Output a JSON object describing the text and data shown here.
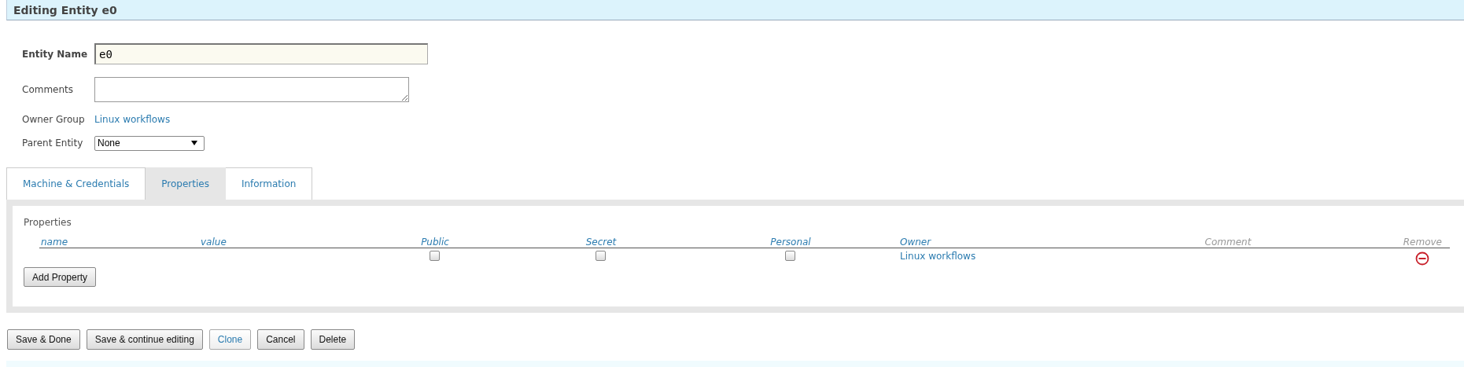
{
  "header": {
    "title": "Editing Entity e0"
  },
  "form": {
    "entity_name": {
      "label": "Entity Name",
      "value": "e0"
    },
    "comments": {
      "label": "Comments"
    },
    "owner_group": {
      "label": "Owner Group",
      "value": "Linux workflows"
    },
    "parent_entity": {
      "label": "Parent Entity",
      "value": "None"
    }
  },
  "tabs": [
    {
      "label": "Machine & Credentials",
      "selected": false
    },
    {
      "label": "Properties",
      "selected": true
    },
    {
      "label": "Information",
      "selected": false
    }
  ],
  "properties": {
    "title": "Properties",
    "columns": [
      {
        "label": "name",
        "kind": "text"
      },
      {
        "label": "value",
        "kind": "text"
      },
      {
        "label": "Public",
        "kind": "check"
      },
      {
        "label": "Secret",
        "kind": "check"
      },
      {
        "label": "Personal",
        "kind": "check"
      },
      {
        "label": "Owner",
        "kind": "link"
      },
      {
        "label": "Comment",
        "kind": "muted"
      },
      {
        "label": "Remove",
        "kind": "remove"
      }
    ],
    "rows": [
      {
        "public": false,
        "secret": false,
        "personal": false,
        "owner": "Linux workflows"
      }
    ],
    "add_button": "Add Property"
  },
  "buttons": [
    {
      "label": "Save & Done",
      "kind": "normal"
    },
    {
      "label": "Save & continue editing",
      "kind": "normal"
    },
    {
      "label": "Clone",
      "kind": "link"
    },
    {
      "label": "Cancel",
      "kind": "normal"
    },
    {
      "label": "Delete",
      "kind": "normal"
    }
  ]
}
